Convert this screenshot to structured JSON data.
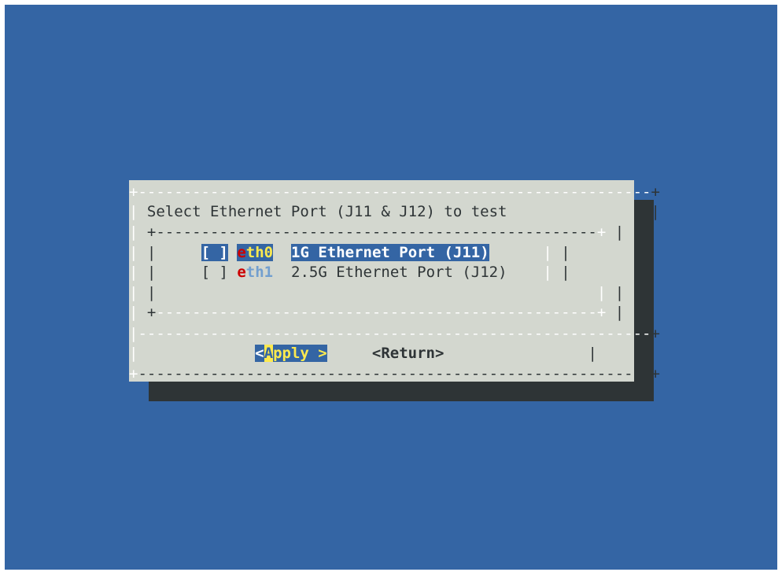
{
  "dialog": {
    "title": "Select Ethernet Port (J11 & J12) to test"
  },
  "options": [
    {
      "checkbox": "[ ]",
      "tag_first": "e",
      "tag_rest": "th0",
      "description": "1G Ethernet Port (J11)",
      "selected": true
    },
    {
      "checkbox": "[ ]",
      "tag_first": "e",
      "tag_rest": "th1",
      "description": "2.5G Ethernet Port (J12)",
      "selected": false
    }
  ],
  "buttons": {
    "apply_open": "<",
    "apply_hotkey": "A",
    "apply_rest": "pply >",
    "return_label": "<Return>"
  },
  "colors": {
    "screen_bg": "#3465a4",
    "dialog_bg": "#d3d7cf",
    "shadow": "#2e3436",
    "hotkey_red": "#cc0000",
    "tag_blue": "#729fcf",
    "highlight_yellow": "#fce94f"
  }
}
